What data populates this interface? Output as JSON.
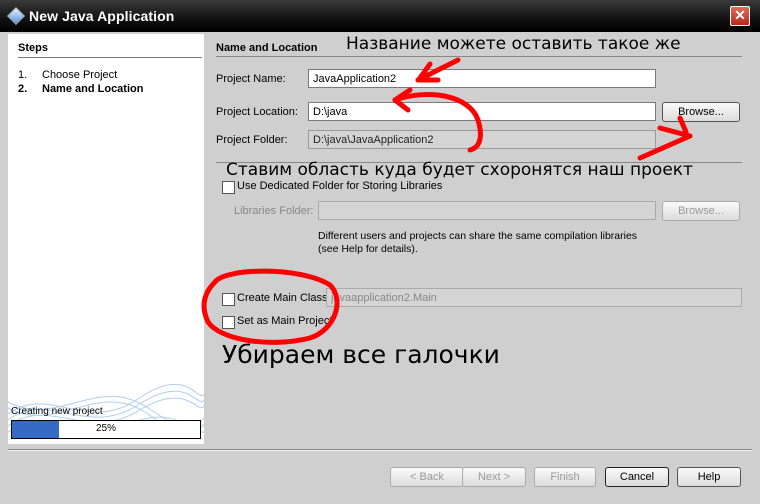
{
  "window": {
    "title": "New Java Application",
    "close_label": "✕"
  },
  "steps": {
    "title": "Steps",
    "items": [
      {
        "num": "1.",
        "label": "Choose Project"
      },
      {
        "num": "2.",
        "label": "Name and Location"
      }
    ]
  },
  "progress": {
    "label": "Creating new project",
    "value_text": "25%",
    "fraction": 0.25
  },
  "panel": {
    "title": "Name and Location",
    "project_name": {
      "label": "Project Name:",
      "value": "JavaApplication2"
    },
    "project_location": {
      "label": "Project Location:",
      "value": "D:\\java",
      "browse_label": "Browse..."
    },
    "project_folder": {
      "label": "Project Folder:",
      "value": "D:\\java\\JavaApplication2"
    },
    "dedicated_folder": {
      "label": "Use Dedicated Folder for Storing Libraries",
      "checked": false
    },
    "libraries_folder": {
      "label": "Libraries Folder:",
      "value": "",
      "browse_label": "Browse..."
    },
    "hint_line1": "Different users and projects can share the same compilation libraries",
    "hint_line2": "(see Help for details).",
    "create_main_class": {
      "label": "Create Main Class",
      "value": "javaapplication2.Main",
      "checked": false
    },
    "set_main_project": {
      "label": "Set as Main Project",
      "checked": false
    }
  },
  "buttons": {
    "back": "< Back",
    "next": "Next >",
    "finish": "Finish",
    "cancel": "Cancel",
    "help": "Help"
  },
  "annotations": {
    "top": "Название можете оставить такое же",
    "middle": "Ставим область куда будет схоронятся наш проект",
    "bottom": "Убираем все галочки"
  },
  "colors": {
    "progress_fill": "#356bc4",
    "scribble": "#ff0000",
    "titlebar": "#000000"
  }
}
